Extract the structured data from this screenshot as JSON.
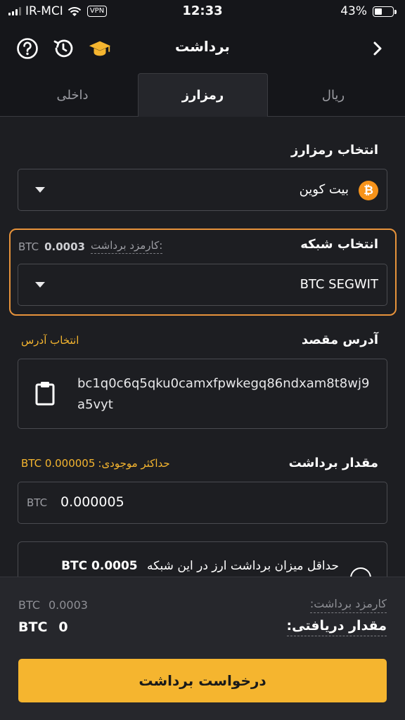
{
  "status_bar": {
    "carrier": "IR-MCI",
    "vpn": "VPN",
    "time": "12:33",
    "battery": "43%",
    "battery_level": 0.43
  },
  "header": {
    "title": "برداشت",
    "icons": [
      "back-chevron-icon",
      "academy-icon",
      "history-icon",
      "help-icon"
    ]
  },
  "tabs": [
    {
      "label": "ریال",
      "active": false
    },
    {
      "label": "رمزارز",
      "active": true
    },
    {
      "label": "داخلی",
      "active": false
    }
  ],
  "crypto_select": {
    "label": "انتخاب رمزارز",
    "value": "بیت کوین",
    "coin_symbol": "₿"
  },
  "network": {
    "label": "انتخاب شبکه",
    "fee_label": "کارمزد برداشت:",
    "fee_amount": "0.0003",
    "fee_unit": "BTC",
    "value": "BTC SEGWIT"
  },
  "destination": {
    "label": "آدرس مقصد",
    "select_address_link": "انتخاب آدرس",
    "address": "bc1q0c6q5qku0camxfpwkegq86ndxam8t8wj9a5vyt"
  },
  "amount": {
    "label": "مقدار برداشت",
    "max_label": "حداکثر موجودی:",
    "max_value": "BTC 0.000005",
    "unit": "BTC",
    "value": "0.000005"
  },
  "info_card": {
    "text": "حداقل میزان برداشت ارز در این شبکه",
    "amount": "BTC 0.0005"
  },
  "summary": {
    "fee_label": "کارمزد برداشت:",
    "fee_unit": "BTC",
    "fee_amount": "0.0003",
    "received_label": "مقدار دریافتی:",
    "received_unit": "BTC",
    "received_amount": "0"
  },
  "submit_label": "درخواست برداشت",
  "colors": {
    "accent": "#f5b52f",
    "highlight_border": "#e7933b",
    "background": "#1d1e22",
    "bitcoin": "#f7931a"
  }
}
